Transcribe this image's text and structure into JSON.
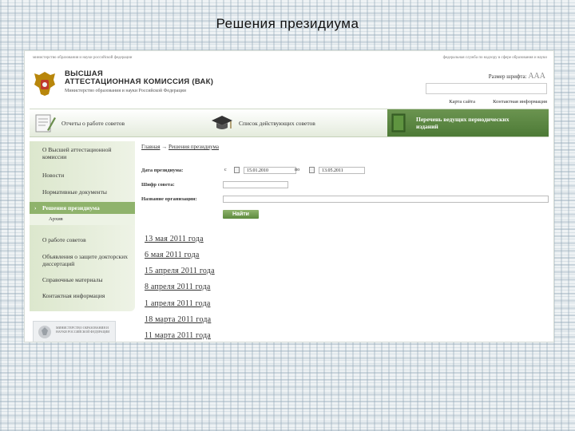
{
  "slide": {
    "title": "Решения президиума"
  },
  "header": {
    "ministry_line": "министерство образования и науки российской федерации",
    "federal_line": "федеральная служба по надзору в сфере образования и науки",
    "org_name_line1": "ВЫСШАЯ",
    "org_name_line2": "АТТЕСТАЦИОННАЯ КОМИССИЯ (ВАК)",
    "org_sub": "Министерство образования и науки Российской Федерации",
    "font_size_label": "Размер шрифта:",
    "font_size_glyphs": "AAA",
    "sitemap_link": "Карта сайта",
    "contacts_link": "Контактная информация"
  },
  "menu": {
    "reports": "Отчеты о работе советов",
    "councils": "Список действующих советов",
    "journals": "Перечень ведущих периодических изданий"
  },
  "sidebar": {
    "items": [
      "О Высшей аттестационной комиссии",
      "Новости",
      "Нормативные документы",
      "Решения президиума",
      "Архив",
      "О работе советов",
      "Объявления о защите докторских диссертаций",
      "Справочные материалы",
      "Контактная информация"
    ]
  },
  "sponsor": {
    "text": "МИНИСТЕРСТВО ОБРАЗОВАНИЯ И НАУКИ РОССИЙСКОЙ ФЕДЕРАЦИИ"
  },
  "breadcrumb": {
    "home": "Главная",
    "arrow": "→",
    "current": "Решения президиума"
  },
  "form": {
    "date_label": "Дата президиума:",
    "from_label": "с",
    "from_value": "15.01.2010",
    "to_label": "по",
    "to_value": "13.05.2011",
    "cipher_label": "Шифр совета:",
    "org_label": "Название организации:",
    "search_button": "Найти"
  },
  "results": [
    "13 мая 2011 года",
    "6 мая 2011 года",
    "15 апреля 2011 года",
    "8 апреля 2011 года",
    "1 апреля 2011 года",
    "18 марта 2011 года",
    "11 марта 2011 года"
  ]
}
